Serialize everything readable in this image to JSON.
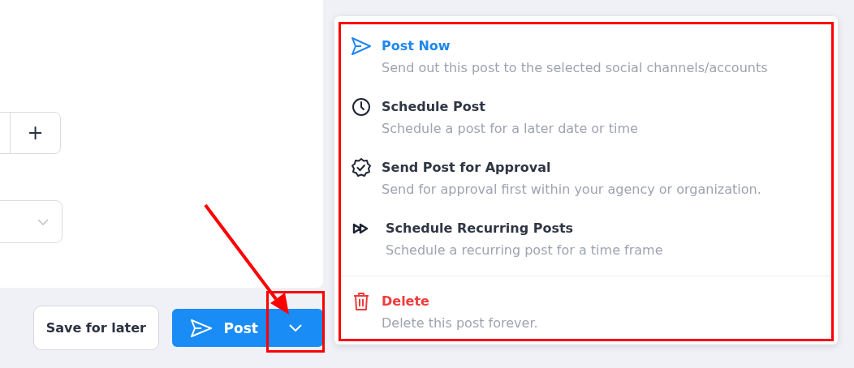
{
  "quantity_field": {
    "increment": "+"
  },
  "dropdown": {
    "open": false
  },
  "save_button": {
    "label": "Save for later"
  },
  "post_button": {
    "label": "Post"
  },
  "menu": {
    "groups": [
      [
        {
          "kind": "send",
          "title": "Post Now",
          "description": "Send out this post to the selected social channels/accounts",
          "selected": true
        },
        {
          "kind": "schedule",
          "title": "Schedule Post",
          "description": "Schedule a post for a later date or time",
          "selected": false
        },
        {
          "kind": "approval",
          "title": "Send Post for Approval",
          "description": "Send for approval first within your agency or organization.",
          "selected": false
        },
        {
          "kind": "recurring",
          "title": "Schedule Recurring Posts",
          "description": "Schedule a recurring post for a time frame",
          "selected": false
        }
      ],
      [
        {
          "kind": "delete",
          "title": "Delete",
          "description": "Delete this post forever.",
          "selected": false
        }
      ]
    ]
  }
}
